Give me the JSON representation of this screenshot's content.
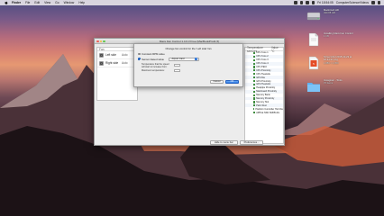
{
  "menubar": {
    "app_name": "Finder",
    "items": [
      "File",
      "Edit",
      "View",
      "Go",
      "Window",
      "Help"
    ],
    "status_text": "Fri 18:54:05",
    "user": "ComputerScienceVideos"
  },
  "main_window": {
    "title": "Macs Fan Control 1.4.6.3 Free (MacBookPro11,5)",
    "fan_header": "Fan",
    "fans": [
      {
        "name": "Left side",
        "value": "Auto"
      },
      {
        "name": "Right side",
        "value": "Auto"
      }
    ],
    "sensor_header": "Temperature sensors",
    "sensor_value_header": "Value °C",
    "sensors": [
      "CPU Core 1",
      "CPU Core 2",
      "CPU Core 3",
      "CPU Core 4",
      "CPU PECI",
      "CPU Proximity",
      "CPU Heatsink",
      "GPU Die",
      "GPU Proximity",
      "GPU Heatsink",
      "Heatpipe Proximity",
      "Mainboard Proximity",
      "Memory Bank",
      "Memory Proximity",
      "Memory Slot",
      "Palm Rest",
      "Platform Controller Hub Die"
    ],
    "battery_row": "APPLE SSD SM0512G",
    "hide_button": "Hide to menu bar",
    "preferences_button": "Preferences..."
  },
  "sheet": {
    "title": "Change fan control for the 'Left side' fan",
    "option_constant": "Constant RPM value",
    "option_sensor": "Sensor-based value",
    "sensor_select": "Airport Card",
    "temp_start_label": "Temperature that the speed will start to increase from:",
    "temp_max_label": "Maximum temperature:",
    "cancel": "Cancel",
    "ok": "OK"
  },
  "desktop_items": [
    {
      "title": "Macintosh HD",
      "meta": "499.88 GB"
    },
    {
      "title": "Installing Macs Fan Control",
      "meta": "1 KB"
    },
    {
      "title": "Screenshot 2015-10-23 at 18.34.37.png",
      "meta": "1,880 × 1,050"
    },
    {
      "title": "Instagram - Tools",
      "meta": "76 items"
    }
  ]
}
